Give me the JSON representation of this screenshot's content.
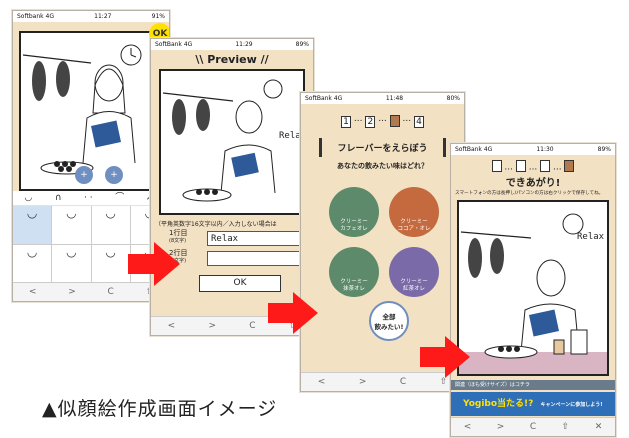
{
  "caption": "▲似顔絵作成画面イメージ",
  "screen1": {
    "carrier": "Softbank 4G",
    "time": "11:27",
    "battery": "91%",
    "ok_label": "OK",
    "plus_a": "+",
    "plus_b": "+",
    "tools": [
      "◡",
      "∩",
      "· ·",
      "⌒",
      "ᨓ"
    ]
  },
  "screen2": {
    "carrier": "SoftBank 4G",
    "time": "11:29",
    "battery": "89%",
    "title": "\\\\ Preview //",
    "relax": "Relax",
    "note": "（平角英数字16文字以内／入力しない場合は",
    "line1_label": "1行目",
    "line1_sub": "(8文字)",
    "line1_value": "Relax",
    "line2_label": "2行目",
    "line2_sub": "(8文字)",
    "line2_value": "",
    "ok_label": "OK"
  },
  "screen3": {
    "carrier": "SoftBank 4G",
    "time": "11:48",
    "battery": "80%",
    "step1": "1",
    "step2": "2",
    "step4": "4",
    "heading": "フレーバーをえらぼう",
    "question": "あなたの飲みたい味はどれ？",
    "flavors": [
      {
        "name": "クリーミー\nカフェオレ",
        "color": "#b07a4e"
      },
      {
        "name": "クリーミー\nココア・オレ",
        "color": "#8c5a3c"
      },
      {
        "name": "クリーミー\n抹茶オレ",
        "color": "#7aa05a"
      },
      {
        "name": "クリーミー\n紅茶オレ",
        "color": "#7a6aa8"
      }
    ],
    "all_label": "全部\n飲みたい!"
  },
  "screen4": {
    "carrier": "SoftBank 4G",
    "time": "11:30",
    "battery": "89%",
    "done": "できあがり!",
    "save_note": "スマートフォンの方は長押し/パソコンの方は右クリックで保存してね。",
    "relax": "Relax",
    "ad_text": "関連（ほも受けサイズ）はコチラ",
    "yogibo": "Yogibo当たる!?",
    "campaign": "キャンペーンに参加しよう!"
  },
  "browser": {
    "back": "<",
    "forward": ">",
    "reload": "C",
    "share": "⇧",
    "close": "✕"
  },
  "colors": {
    "page_bg": "#f3e1c4",
    "arrow": "#ff1a1a",
    "ok": "#ffe100",
    "accent_blue": "#6f8fc0"
  }
}
